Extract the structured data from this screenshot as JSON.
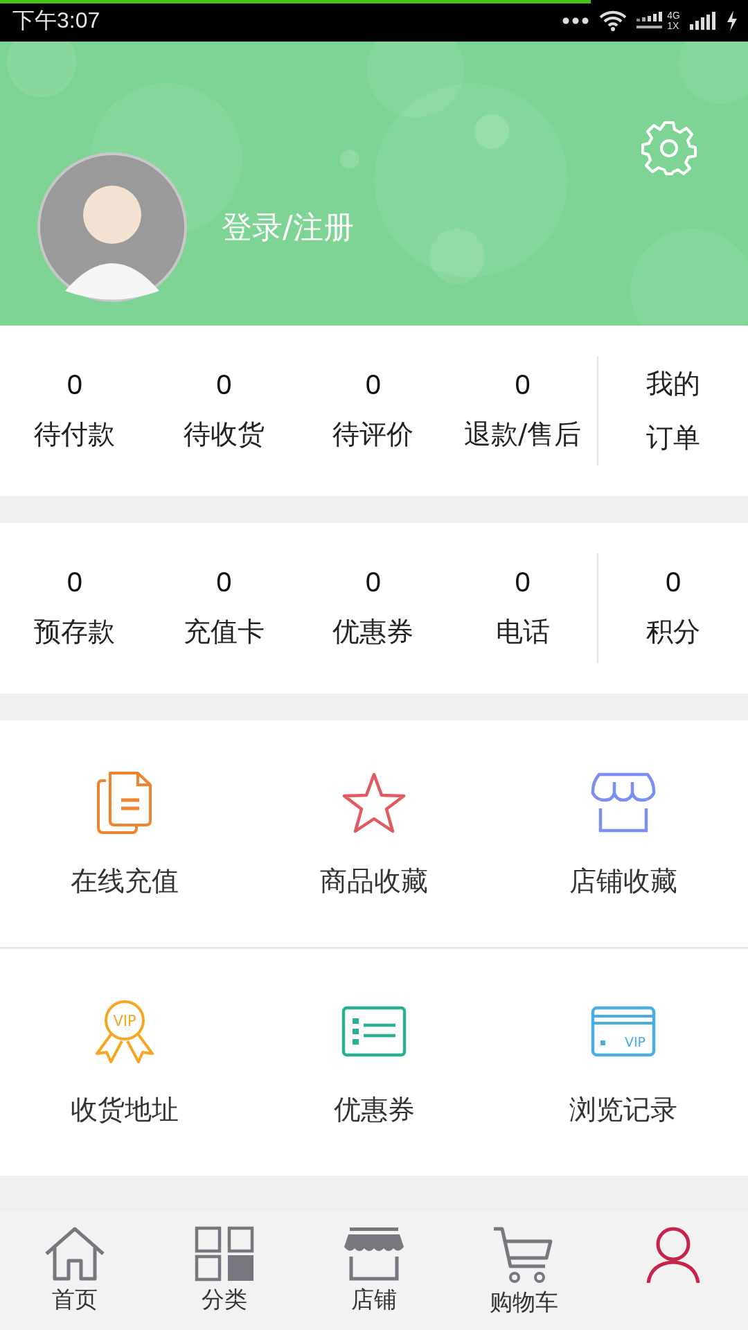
{
  "status_bar": {
    "time": "下午3:07",
    "network_top": "4G",
    "network_bottom": "1X",
    "loading": {
      "level": 0.79
    }
  },
  "header": {
    "login_label": "登录/注册"
  },
  "stats_rows": [
    {
      "items": [
        {
          "kind": "count",
          "value": "0",
          "label": "待付款"
        },
        {
          "kind": "count",
          "value": "0",
          "label": "待收货"
        },
        {
          "kind": "count",
          "value": "0",
          "label": "待评价"
        },
        {
          "kind": "count",
          "value": "0",
          "label": "退款/售后"
        },
        {
          "kind": "link",
          "lines": [
            "我的",
            "订单"
          ]
        }
      ]
    },
    {
      "items": [
        {
          "kind": "count",
          "value": "0",
          "label": "预存款"
        },
        {
          "kind": "count",
          "value": "0",
          "label": "充值卡"
        },
        {
          "kind": "count",
          "value": "0",
          "label": "优惠券"
        },
        {
          "kind": "count",
          "value": "0",
          "label": "电话"
        },
        {
          "kind": "count",
          "value": "0",
          "label": "积分"
        }
      ]
    }
  ],
  "shortcuts": [
    {
      "kind": "documents",
      "label": "在线充值"
    },
    {
      "kind": "star",
      "label": "商品收藏"
    },
    {
      "kind": "shop",
      "label": "店铺收藏"
    },
    {
      "kind": "ribbon",
      "label": "收货地址",
      "icon_text": "VIP"
    },
    {
      "kind": "list",
      "label": "优惠券"
    },
    {
      "kind": "card",
      "label": "浏览记录",
      "icon_text": "VIP"
    }
  ],
  "tabs": [
    {
      "kind": "home",
      "label": "首页",
      "selected": false
    },
    {
      "kind": "grid",
      "label": "分类",
      "selected": false
    },
    {
      "kind": "shop",
      "label": "店铺",
      "selected": false
    },
    {
      "kind": "cart",
      "label": "购物车",
      "selected": false
    },
    {
      "kind": "person",
      "selected": true
    }
  ]
}
